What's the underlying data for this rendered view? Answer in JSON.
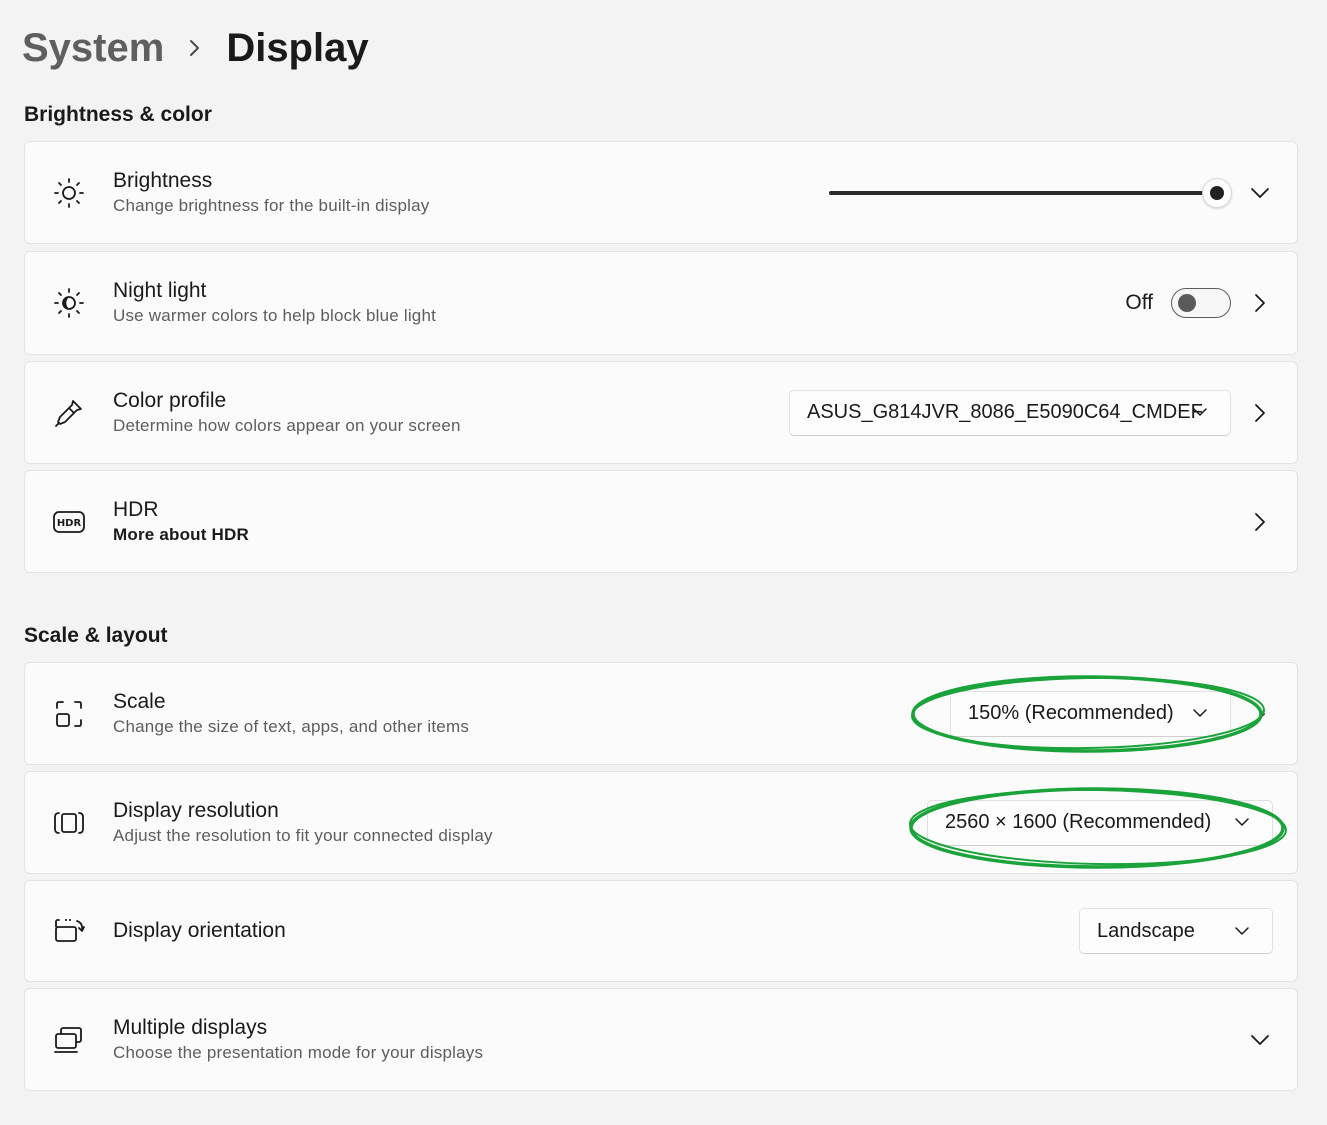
{
  "breadcrumb": {
    "parent": "System",
    "current": "Display"
  },
  "sections": {
    "brightness_color": "Brightness & color",
    "scale_layout": "Scale & layout"
  },
  "brightness": {
    "title": "Brightness",
    "subtitle": "Change brightness for the built-in display",
    "value_percent": 100,
    "icon": "sun-icon"
  },
  "night_light": {
    "title": "Night light",
    "subtitle": "Use warmer colors to help block blue light",
    "state_label": "Off",
    "on": false,
    "icon": "night-light-icon"
  },
  "color_profile": {
    "title": "Color profile",
    "subtitle": "Determine how colors appear on your screen",
    "selected": "ASUS_G814JVR_8086_E5090C64_CMDEF",
    "icon": "eyedropper-icon"
  },
  "hdr": {
    "title": "HDR",
    "subtitle": "More about HDR",
    "icon_text": "HDR",
    "icon": "hdr-icon"
  },
  "scale": {
    "title": "Scale",
    "subtitle": "Change the size of text, apps, and other items",
    "selected": "150% (Recommended)",
    "icon": "scale-icon"
  },
  "resolution": {
    "title": "Display resolution",
    "subtitle": "Adjust the resolution to fit your connected display",
    "selected": "2560 × 1600 (Recommended)",
    "icon": "resolution-icon"
  },
  "orientation": {
    "title": "Display orientation",
    "selected": "Landscape",
    "icon": "orientation-icon"
  },
  "multiple_displays": {
    "title": "Multiple displays",
    "subtitle": "Choose the presentation mode for your displays",
    "icon": "multiple-displays-icon"
  },
  "colors": {
    "annotation_green": "#1aa33a",
    "toggle_off": "#5a5a5a",
    "slider_fill": "#2b2b2b"
  }
}
